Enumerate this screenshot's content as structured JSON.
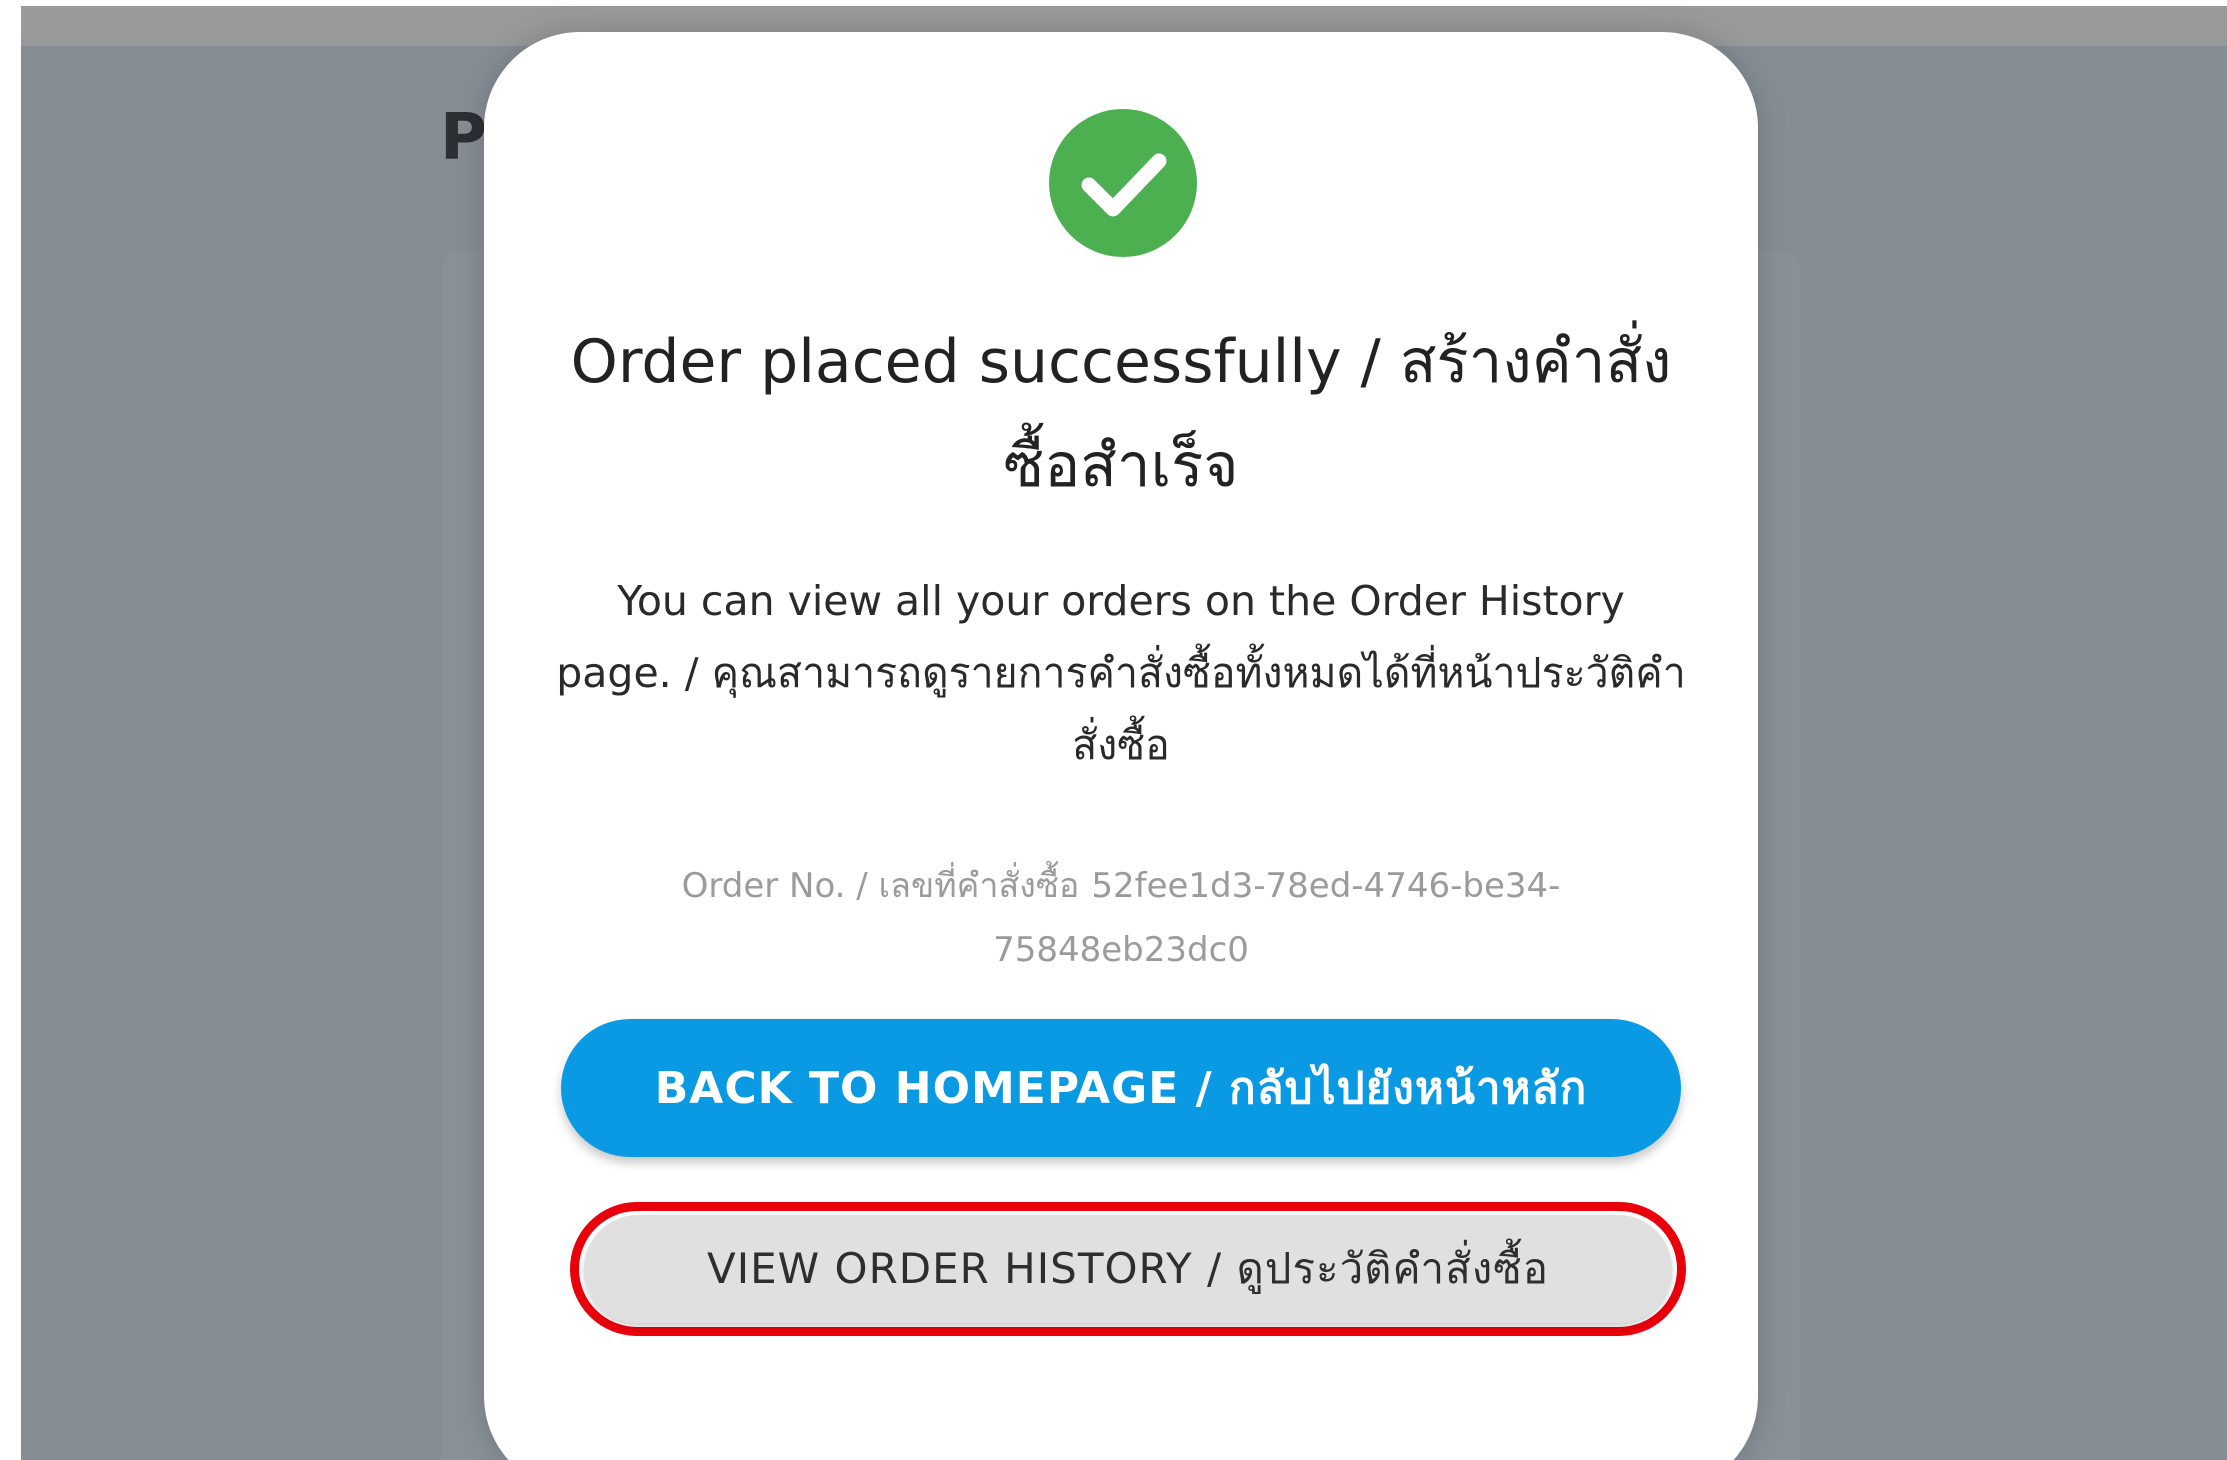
{
  "page": {
    "heading_fragment": "P"
  },
  "modal": {
    "icon": "check-circle-icon",
    "title": "Order placed successfully / สร้างคำสั่งซื้อสำเร็จ",
    "message": "You can view all your orders on the Order History page. / คุณสามารถดูรายการคำสั่งซื้อทั้งหมดได้ที่หน้าประวัติคำสั่งซื้อ",
    "order_label": "Order No. / เลขที่คำสั่งซื้อ",
    "order_id": "52fee1d3-78ed-4746-be34-75848eb23dc0",
    "back_button": "BACK TO HOMEPAGE / กลับไปยังหน้าหลัก",
    "history_button": "VIEW ORDER HISTORY / ดูประวัติคำสั่งซื้อ"
  },
  "colors": {
    "success": "#4caf50",
    "primary": "#0a99e3",
    "highlight": "#e8000b",
    "overlay": "#868d95"
  }
}
